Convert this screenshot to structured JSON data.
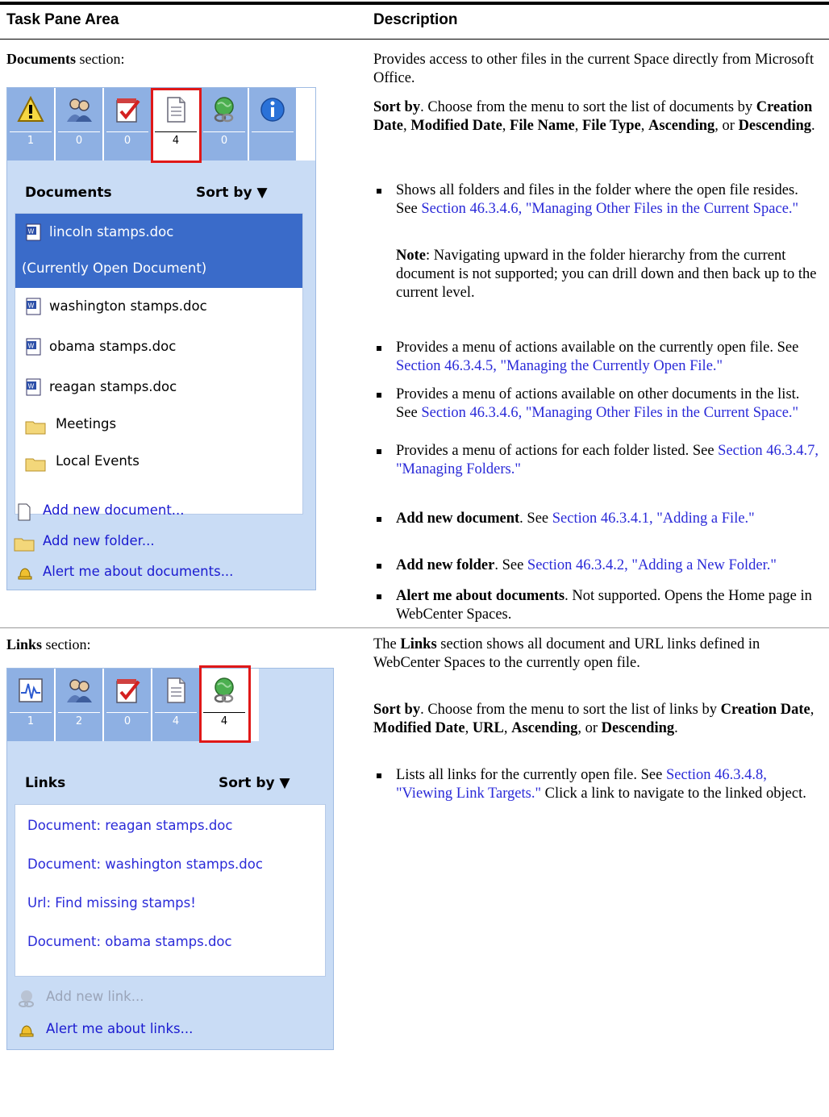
{
  "table": {
    "col1_header": "Task Pane Area",
    "col2_header": "Description"
  },
  "documents_row": {
    "label_bold": "Documents",
    "label_rest": " section:",
    "intro": "Provides access to other files in the current Space directly from Microsoft Office.",
    "sortby_bold": "Sort by",
    "sortby_text_1": ". Choose from the menu to sort the list of documents by ",
    "sortby_opt1": "Creation Date",
    "sortby_opt2": "Modified Date",
    "sortby_opt3": "File Name",
    "sortby_opt4": "File Type",
    "sortby_opt5": "Ascending",
    "sortby_or": ", or ",
    "sortby_opt6": "Descending",
    "bullet1_text": "Shows all folders and files in the folder where the open file resides. See ",
    "bullet1_link": "Section 46.3.4.6, \"Managing Other Files in the Current Space.\"",
    "note_bold": "Note",
    "note_text": ": Navigating upward in the folder hierarchy from the current document is not supported; you can drill down and then back up to the current level.",
    "bullet2_text": "Provides a menu of actions available on the currently open file. See ",
    "bullet2_link": "Section 46.3.4.5, \"Managing the Currently Open File.\"",
    "bullet3_text": "Provides a menu of actions available on other documents in the list. See ",
    "bullet3_link": "Section 46.3.4.6, \"Managing Other Files in the Current Space.\"",
    "bullet4_text": "Provides a menu of actions for each folder listed. See ",
    "bullet4_link": "Section 46.3.4.7, \"Managing Folders.\"",
    "bullet5_bold": "Add new document",
    "bullet5_text": ". See ",
    "bullet5_link": "Section 46.3.4.1, \"Adding a File.\"",
    "bullet6_bold": "Add new folder",
    "bullet6_text": ". See ",
    "bullet6_link": "Section 46.3.4.2, \"Adding a New Folder.\"",
    "bullet7_bold": "Alert me about documents",
    "bullet7_text": ". Not supported. Opens the Home page in WebCenter Spaces."
  },
  "documents_pane": {
    "counts": [
      "1",
      "0",
      "0",
      "4",
      "0"
    ],
    "title": "Documents",
    "sort_label": "Sort by",
    "selected_item": "lincoln stamps.doc",
    "selected_subtitle": "(Currently Open Document)",
    "items": [
      "washington stamps.doc",
      "obama stamps.doc",
      "reagan stamps.doc"
    ],
    "folders": [
      "Meetings",
      "Local Events"
    ],
    "footer": [
      "Add new document...",
      "Add new folder...",
      "Alert me about documents..."
    ]
  },
  "links_row": {
    "label_bold": "Links",
    "label_rest": " section:",
    "intro_1": "The ",
    "intro_bold": "Links",
    "intro_2": " section shows all document and URL links defined in WebCenter Spaces to the currently open file.",
    "sortby_bold": "Sort by",
    "sortby_text_1": ". Choose from the menu to sort the list of links by ",
    "sortby_opt1": "Creation Date",
    "sortby_opt2": "Modified Date",
    "sortby_opt3": "URL",
    "sortby_opt4": "Ascending",
    "sortby_or": ", or ",
    "sortby_opt5": "Descending",
    "bullet1_text": "Lists all links for the currently open file. See ",
    "bullet1_link": "Section 46.3.4.8, \"Viewing Link Targets.\"",
    "bullet1_tail": " Click a link to navigate to the linked object."
  },
  "links_pane": {
    "counts": [
      "1",
      "2",
      "0",
      "4",
      "4"
    ],
    "title": "Links",
    "sort_label": "Sort by",
    "items": [
      "Document: reagan stamps.doc",
      "Document: washington stamps.doc",
      "Url: Find missing stamps!",
      "Document: obama stamps.doc"
    ],
    "footer": [
      "Add new link...",
      "Alert me about links..."
    ]
  },
  "colors": {
    "link": "#2a2ad8",
    "pane_bg": "#c9dcf5",
    "icon_tile": "#8eb0e3",
    "selected_row": "#3a6bc9",
    "highlight_box": "#e01818"
  }
}
